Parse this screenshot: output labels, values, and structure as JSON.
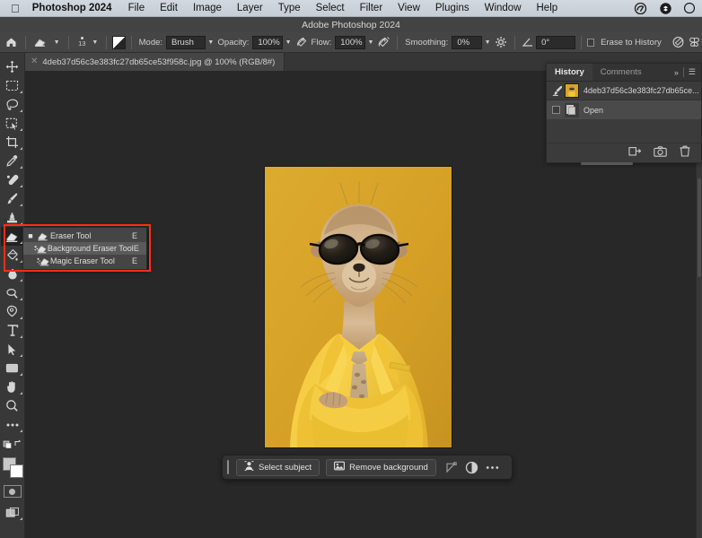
{
  "mac_menubar": {
    "apple_icon": "apple-logo",
    "app_name": "Photoshop 2024",
    "menus": [
      "File",
      "Edit",
      "Image",
      "Layer",
      "Type",
      "Select",
      "Filter",
      "View",
      "Plugins",
      "Window",
      "Help"
    ],
    "status_icons": [
      "creative-cloud-icon",
      "dropbox-icon",
      "control-center-icon"
    ]
  },
  "title_bar": {
    "title": "Adobe Photoshop 2024"
  },
  "options_bar": {
    "home_icon": "home-icon",
    "tool_preset_icon": "eraser-preset-icon",
    "brush_size": "13",
    "toggle_icon": "airbrush-toggle-icon",
    "mode_label": "Mode:",
    "mode_value": "Brush",
    "opacity_label": "Opacity:",
    "opacity_value": "100%",
    "opacity_pressure_icon": "pressure-opacity-icon",
    "flow_label": "Flow:",
    "flow_value": "100%",
    "flow_pressure_icon": "pressure-flow-icon",
    "smoothing_label": "Smoothing:",
    "smoothing_value": "0%",
    "smoothing_options_icon": "gear-icon",
    "angle_icon": "angle-icon",
    "angle_value": "0°",
    "erase_to_history_label": "Erase to History",
    "tablet_pressure_icon": "tablet-pressure-icon",
    "symmetry_icon": "butterfly-symmetry-icon"
  },
  "document_tab": {
    "close_icon": "close-icon",
    "title": "4deb37d56c3e383fc27db65ce53f958c.jpg @ 100% (RGB/8#)"
  },
  "toolbar": {
    "tools": [
      {
        "name": "move-tool",
        "icon": "move-icon",
        "has_flyout": false
      },
      {
        "name": "rectangular-marquee-tool",
        "icon": "marquee-icon",
        "has_flyout": true
      },
      {
        "name": "lasso-tool",
        "icon": "lasso-icon",
        "has_flyout": true
      },
      {
        "name": "object-selection-tool",
        "icon": "object-selection-icon",
        "has_flyout": true
      },
      {
        "name": "crop-tool",
        "icon": "crop-icon",
        "has_flyout": true
      },
      {
        "name": "eyedropper-tool",
        "icon": "eyedropper-icon",
        "has_flyout": true
      },
      {
        "name": "spot-healing-brush-tool",
        "icon": "healing-brush-icon",
        "has_flyout": true
      },
      {
        "name": "brush-tool",
        "icon": "brush-icon",
        "has_flyout": true
      },
      {
        "name": "clone-stamp-tool",
        "icon": "clone-stamp-icon",
        "has_flyout": true
      },
      {
        "name": "eraser-tool",
        "icon": "eraser-icon",
        "has_flyout": true,
        "active": true
      },
      {
        "name": "gradient-tool",
        "icon": "paint-bucket-icon",
        "has_flyout": true
      },
      {
        "name": "blur-tool",
        "icon": "blur-drop-icon",
        "has_flyout": true
      },
      {
        "name": "dodge-tool",
        "icon": "dodge-icon",
        "has_flyout": true
      },
      {
        "name": "pen-tool",
        "icon": "pen-icon",
        "has_flyout": true
      },
      {
        "name": "type-tool",
        "icon": "type-icon",
        "has_flyout": true
      },
      {
        "name": "path-selection-tool",
        "icon": "path-arrow-icon",
        "has_flyout": true
      },
      {
        "name": "rectangle-tool",
        "icon": "rectangle-icon",
        "has_flyout": true
      },
      {
        "name": "hand-tool",
        "icon": "hand-icon",
        "has_flyout": true
      },
      {
        "name": "zoom-tool",
        "icon": "magnifier-icon",
        "has_flyout": false
      },
      {
        "name": "edit-toolbar-tool",
        "icon": "ellipsis-icon",
        "has_flyout": true
      }
    ],
    "foreground_background": {
      "name": "foreground-background-colors",
      "foreground": "#c9c9c9",
      "background": "#ffffff"
    },
    "quick_mask": {
      "name": "quick-mask-button",
      "icon": "quick-mask-icon"
    },
    "screen_mode": {
      "name": "screen-mode-button",
      "icon": "screen-mode-icon"
    },
    "default_colors_icon": "default-colors-icon",
    "swap_colors_icon": "swap-colors-icon"
  },
  "tool_flyout": {
    "highlight_color": "#ff2d16",
    "items": [
      {
        "label": "Eraser Tool",
        "shortcut": "E",
        "icon": "eraser-icon",
        "selected": true,
        "hovered": false
      },
      {
        "label": "Background Eraser Tool",
        "shortcut": "E",
        "icon": "background-eraser-icon",
        "selected": false,
        "hovered": true
      },
      {
        "label": "Magic Eraser Tool",
        "shortcut": "E",
        "icon": "magic-eraser-icon",
        "selected": false,
        "hovered": false
      }
    ]
  },
  "canvas": {
    "zoom": "100%",
    "image_description": "Meerkat wearing sunglasses and a yellow suit with patterned tie on a mustard yellow background",
    "background_color": "#d9a429",
    "suit_color": "#f2c537",
    "fur_color": "#c7a276"
  },
  "contextual_taskbar": {
    "grip_icon": "drag-grip-icon",
    "buttons": [
      {
        "label": "Select subject",
        "icon": "person-select-icon"
      },
      {
        "label": "Remove background",
        "icon": "image-icon"
      }
    ],
    "icon_buttons": [
      {
        "name": "transform-icon"
      },
      {
        "name": "adjustment-layer-icon"
      },
      {
        "name": "more-options-icon"
      }
    ]
  },
  "history_panel": {
    "tabs": [
      {
        "label": "History",
        "active": true
      },
      {
        "label": "Comments",
        "active": false
      }
    ],
    "collapse_icon": "chevrons-right-icon",
    "menu_icon": "panel-menu-icon",
    "snapshot": {
      "brush_icon": "history-brush-icon",
      "label": "4deb37d56c3e383fc27db65ce...",
      "thumbnail": "document-thumbnail"
    },
    "states": [
      {
        "label": "Open",
        "icon": "open-document-icon",
        "selected": true
      }
    ],
    "footer_icons": [
      {
        "name": "create-document-from-state-icon"
      },
      {
        "name": "create-snapshot-icon"
      },
      {
        "name": "delete-state-icon"
      }
    ]
  }
}
